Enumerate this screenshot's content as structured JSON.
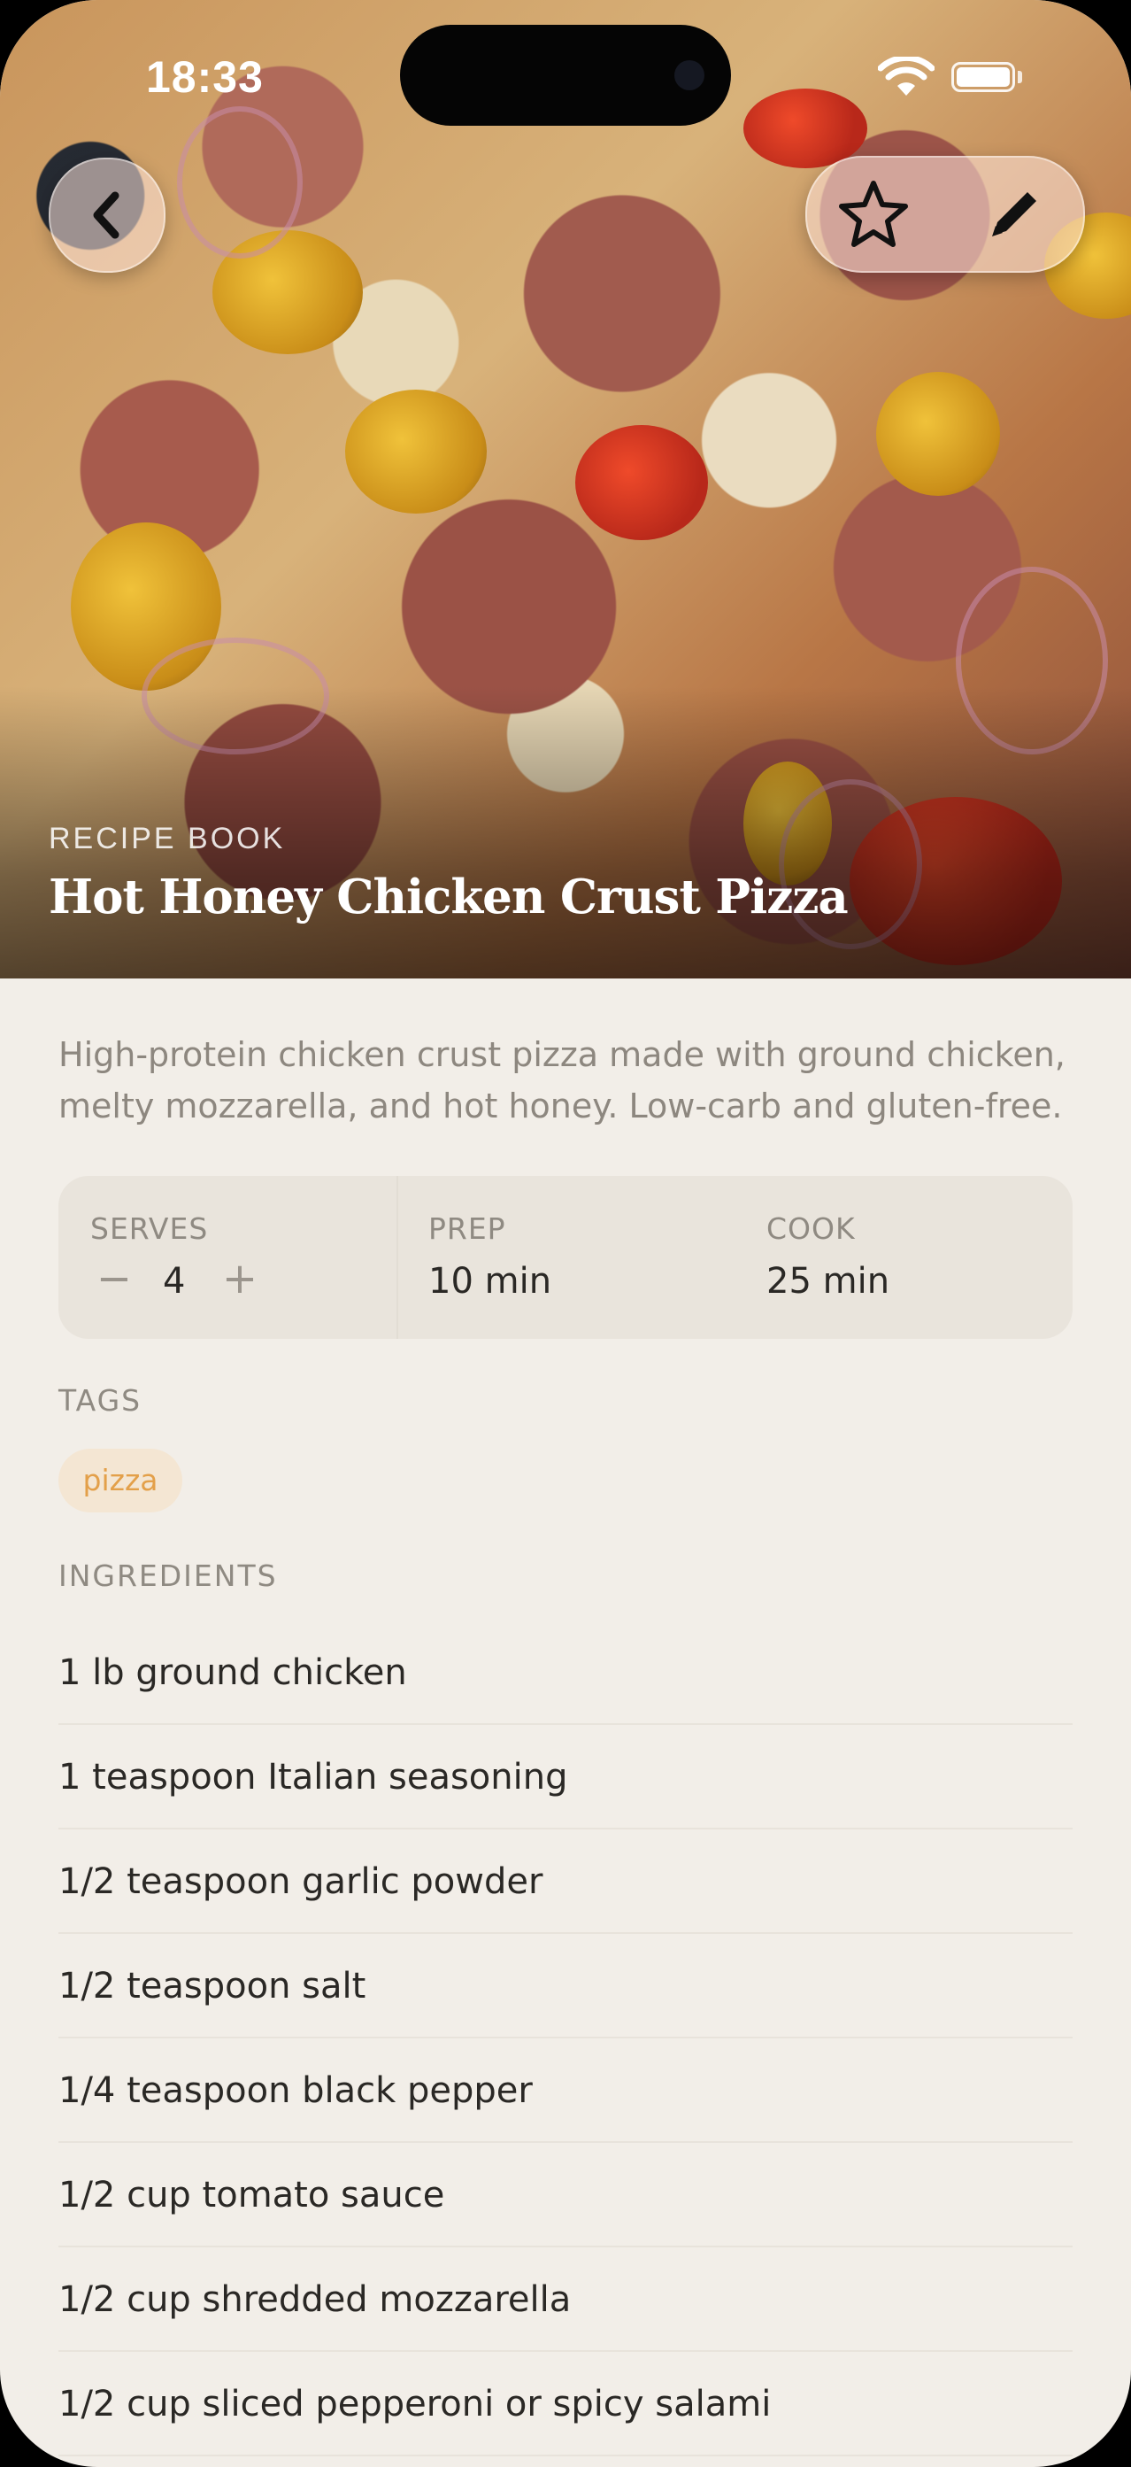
{
  "status_bar": {
    "time": "18:33"
  },
  "header": {
    "back_icon": "chevron-left-icon",
    "favorite_icon": "star-icon",
    "edit_icon": "pencil-icon"
  },
  "recipe": {
    "subtitle": "RECIPE BOOK",
    "title": "Hot Honey Chicken Crust Pizza",
    "description": "High-protein chicken crust pizza made with ground chicken, melty mozzarella, and hot honey. Low-carb and gluten-free."
  },
  "meta": {
    "serves_label": "SERVES",
    "serves_value": "4",
    "minus": "−",
    "plus": "+",
    "prep_label": "PREP",
    "prep_value": "10 min",
    "cook_label": "COOK",
    "cook_value": "25 min"
  },
  "tags": {
    "label": "TAGS",
    "items": [
      "pizza"
    ]
  },
  "ingredients": {
    "label": "INGREDIENTS",
    "items": [
      "1 lb ground chicken",
      "1 teaspoon Italian seasoning",
      "1/2 teaspoon garlic powder",
      "1/2 teaspoon salt",
      "1/4 teaspoon black pepper",
      "1/2 cup tomato sauce",
      "1/2 cup shredded mozzarella",
      "1/2 cup sliced pepperoni or spicy salami"
    ]
  },
  "colors": {
    "background": "#F2EEE8",
    "card": "#E9E4DC",
    "tag_bg": "#F4E6D3",
    "tag_text": "#E3A04A",
    "text_primary": "#2a2825",
    "text_muted": "#8f8a82"
  }
}
